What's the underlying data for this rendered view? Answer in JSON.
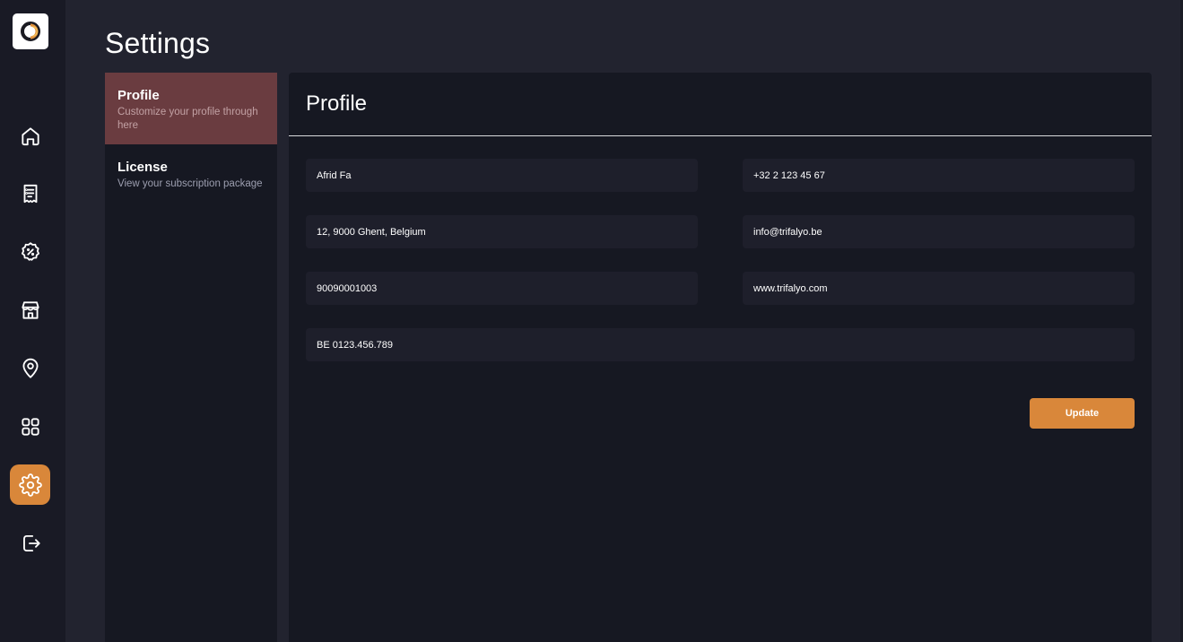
{
  "app": {
    "logo_icon": "brand-logo-icon",
    "accent_color": "#d9873a"
  },
  "nav": {
    "items": [
      {
        "name": "home",
        "icon": "home-icon",
        "active": false
      },
      {
        "name": "receipts",
        "icon": "receipt-icon",
        "active": false
      },
      {
        "name": "discounts",
        "icon": "discount-badge-icon",
        "active": false
      },
      {
        "name": "stores",
        "icon": "store-icon",
        "active": false
      },
      {
        "name": "locations",
        "icon": "map-pin-icon",
        "active": false
      },
      {
        "name": "apps",
        "icon": "grid-icon",
        "active": false
      },
      {
        "name": "settings",
        "icon": "gear-icon",
        "active": true
      },
      {
        "name": "logout",
        "icon": "logout-icon",
        "active": false
      }
    ]
  },
  "page": {
    "title": "Settings"
  },
  "subnav": {
    "items": [
      {
        "title": "Profile",
        "desc": "Customize your profile through here",
        "active": true
      },
      {
        "title": "License",
        "desc": "View your subscription package",
        "active": false
      }
    ]
  },
  "profile": {
    "title": "Profile",
    "fields": {
      "name": "Afrid Fa",
      "phone": "+32 2 123 45 67",
      "address": "12, 9000 Ghent, Belgium",
      "email": "info@trifalyo.be",
      "registration": "90090001003",
      "website": "www.trifalyo.com",
      "vat": "BE 0123.456.789"
    },
    "update_label": "Update"
  }
}
